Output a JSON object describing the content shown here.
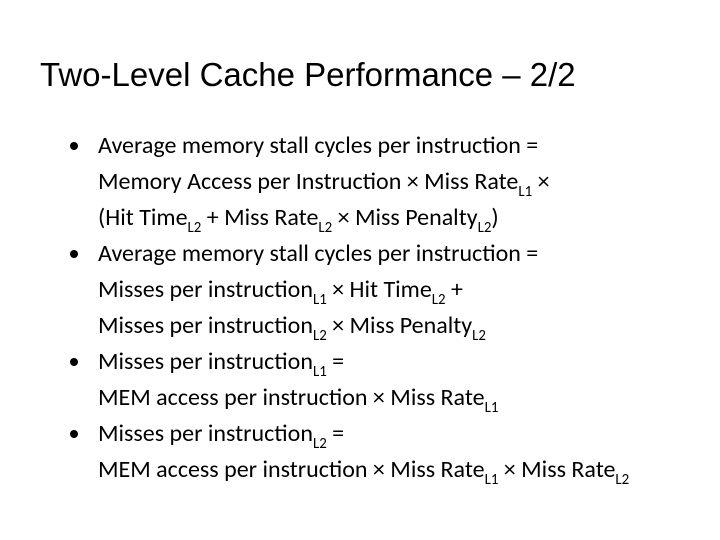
{
  "title": "Two-Level Cache Performance – 2/2",
  "bullets": [
    {
      "lead": "Average memory stall cycles per instruction =",
      "lines": [
        [
          {
            "t": "Memory Access per Instruction × Miss Rate"
          },
          {
            "t": "L1",
            "sub": true
          },
          {
            "t": " ×"
          }
        ],
        [
          {
            "t": "(Hit Time"
          },
          {
            "t": "L2",
            "sub": true
          },
          {
            "t": " + Miss Rate"
          },
          {
            "t": "L2",
            "sub": true
          },
          {
            "t": " × Miss Penalty"
          },
          {
            "t": "L2",
            "sub": true
          },
          {
            "t": ")"
          }
        ]
      ]
    },
    {
      "lead": "Average memory stall cycles per instruction =",
      "lines": [
        [
          {
            "t": "Misses per instruction"
          },
          {
            "t": "L1",
            "sub": true
          },
          {
            "t": " × Hit Time"
          },
          {
            "t": "L2",
            "sub": true
          },
          {
            "t": " +"
          }
        ],
        [
          {
            "t": "Misses per instruction"
          },
          {
            "t": "L2",
            "sub": true
          },
          {
            "t": " × Miss Penalty"
          },
          {
            "t": "L2",
            "sub": true
          }
        ]
      ]
    },
    {
      "lead_rich": [
        {
          "t": "Misses per instruction"
        },
        {
          "t": "L1",
          "sub": true
        },
        {
          "t": " ="
        }
      ],
      "lines": [
        [
          {
            "t": "MEM access per instruction × Miss Rate"
          },
          {
            "t": "L1",
            "sub": true
          }
        ]
      ]
    },
    {
      "lead_rich": [
        {
          "t": "Misses per instruction"
        },
        {
          "t": "L2",
          "sub": true
        },
        {
          "t": " ="
        }
      ],
      "lines": [
        [
          {
            "t": "MEM access per instruction × Miss Rate"
          },
          {
            "t": "L1",
            "sub": true
          },
          {
            "t": " × Miss Rate"
          },
          {
            "t": "L2",
            "sub": true
          }
        ]
      ]
    }
  ]
}
